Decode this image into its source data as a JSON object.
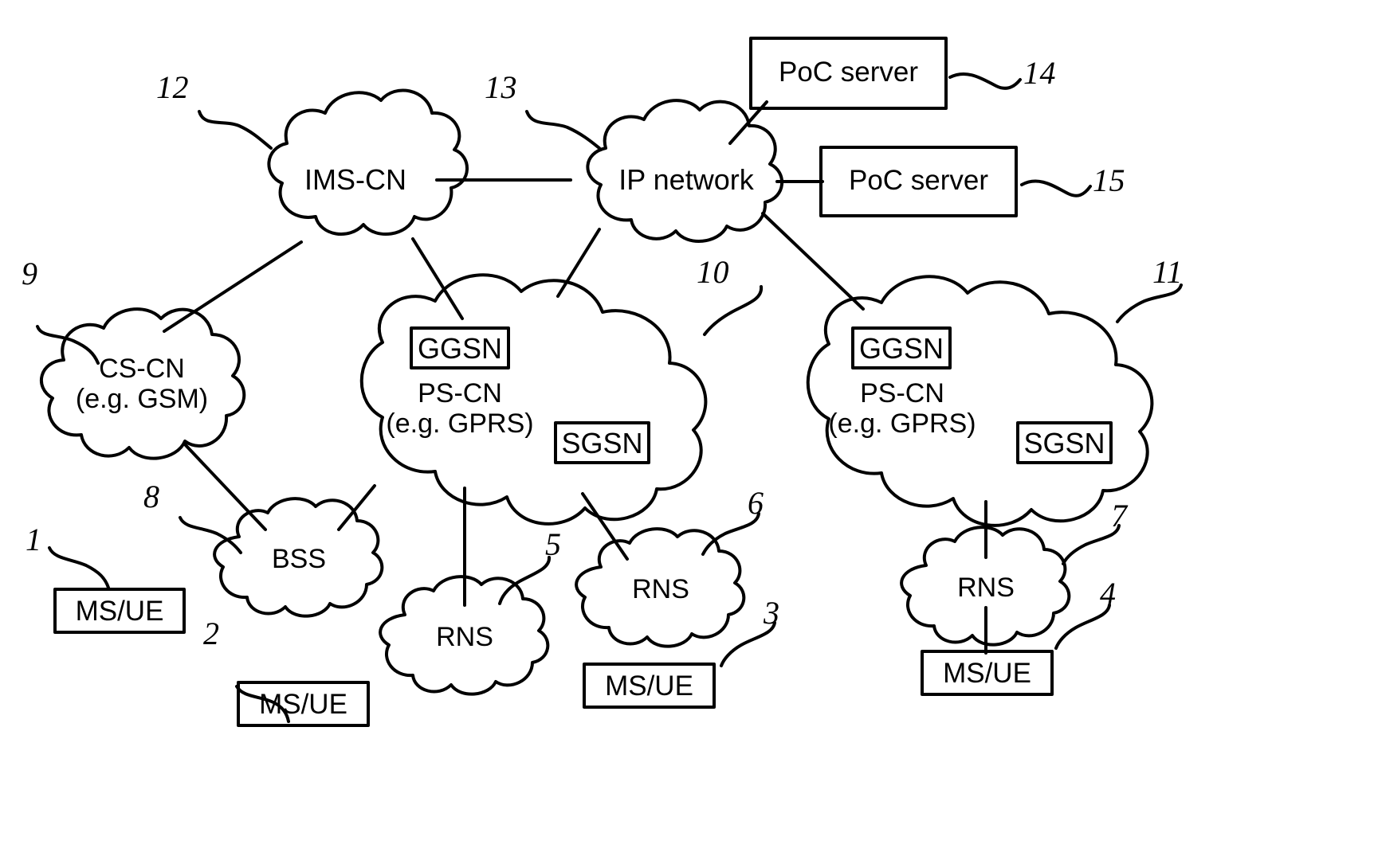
{
  "figure": {
    "title": "Mobile network architecture diagram with PoC servers",
    "stroke_color": "#000000",
    "background_color": "#ffffff"
  },
  "clouds": [
    {
      "id": "ims-cn",
      "label": "IMS-CN",
      "ref": "12"
    },
    {
      "id": "ip-network",
      "label": "IP network",
      "ref": "13"
    },
    {
      "id": "cs-cn",
      "label": "CS-CN\n(e.g. GSM)",
      "ref": "9"
    },
    {
      "id": "ps-cn-left",
      "label": "PS-CN\n(e.g. GPRS)",
      "ref": "10"
    },
    {
      "id": "ps-cn-right",
      "label": "PS-CN\n(e.g. GPRS)",
      "ref": "11"
    },
    {
      "id": "bss",
      "label": "BSS",
      "ref": "8"
    },
    {
      "id": "rns-mid",
      "label": "RNS",
      "ref": "5"
    },
    {
      "id": "rns-right-of-mid",
      "label": "RNS",
      "ref": "6"
    },
    {
      "id": "rns-far-right",
      "label": "RNS",
      "ref": "7"
    }
  ],
  "boxes": [
    {
      "id": "poc-server-14",
      "label": "PoC server",
      "ref": "14"
    },
    {
      "id": "poc-server-15",
      "label": "PoC server",
      "ref": "15"
    },
    {
      "id": "ms-ue-1",
      "label": "MS/UE",
      "ref": "1"
    },
    {
      "id": "ms-ue-2",
      "label": "MS/UE",
      "ref": "2"
    },
    {
      "id": "ms-ue-3",
      "label": "MS/UE",
      "ref": "3"
    },
    {
      "id": "ms-ue-4",
      "label": "MS/UE",
      "ref": "4"
    }
  ],
  "inner_boxes": [
    {
      "id": "ggsn-left",
      "label": "GGSN"
    },
    {
      "id": "sgsn-left",
      "label": "SGSN"
    },
    {
      "id": "ggsn-right",
      "label": "GGSN"
    },
    {
      "id": "sgsn-right",
      "label": "SGSN"
    }
  ],
  "reference_numerals": [
    {
      "id": "ref-1",
      "value": "1"
    },
    {
      "id": "ref-2",
      "value": "2"
    },
    {
      "id": "ref-3",
      "value": "3"
    },
    {
      "id": "ref-4",
      "value": "4"
    },
    {
      "id": "ref-5",
      "value": "5"
    },
    {
      "id": "ref-6",
      "value": "6"
    },
    {
      "id": "ref-7",
      "value": "7"
    },
    {
      "id": "ref-8",
      "value": "8"
    },
    {
      "id": "ref-9",
      "value": "9"
    },
    {
      "id": "ref-10",
      "value": "10"
    },
    {
      "id": "ref-11",
      "value": "11"
    },
    {
      "id": "ref-12",
      "value": "12"
    },
    {
      "id": "ref-13",
      "value": "13"
    },
    {
      "id": "ref-14",
      "value": "14"
    },
    {
      "id": "ref-15",
      "value": "15"
    }
  ],
  "connections": [
    {
      "from": "ims-cn",
      "to": "ip-network"
    },
    {
      "from": "ims-cn",
      "to": "cs-cn"
    },
    {
      "from": "ims-cn",
      "to": "ps-cn-left"
    },
    {
      "from": "ip-network",
      "to": "poc-server-14"
    },
    {
      "from": "ip-network",
      "to": "poc-server-15"
    },
    {
      "from": "ip-network",
      "to": "ps-cn-left"
    },
    {
      "from": "ip-network",
      "to": "ps-cn-right"
    },
    {
      "from": "cs-cn",
      "to": "bss"
    },
    {
      "from": "ps-cn-left",
      "to": "bss"
    },
    {
      "from": "ps-cn-left",
      "to": "rns-mid"
    },
    {
      "from": "ps-cn-left",
      "to": "rns-right-of-mid"
    },
    {
      "from": "ps-cn-right",
      "to": "rns-far-right"
    },
    {
      "from": "rns-far-right",
      "to": "ms-ue-4"
    }
  ]
}
